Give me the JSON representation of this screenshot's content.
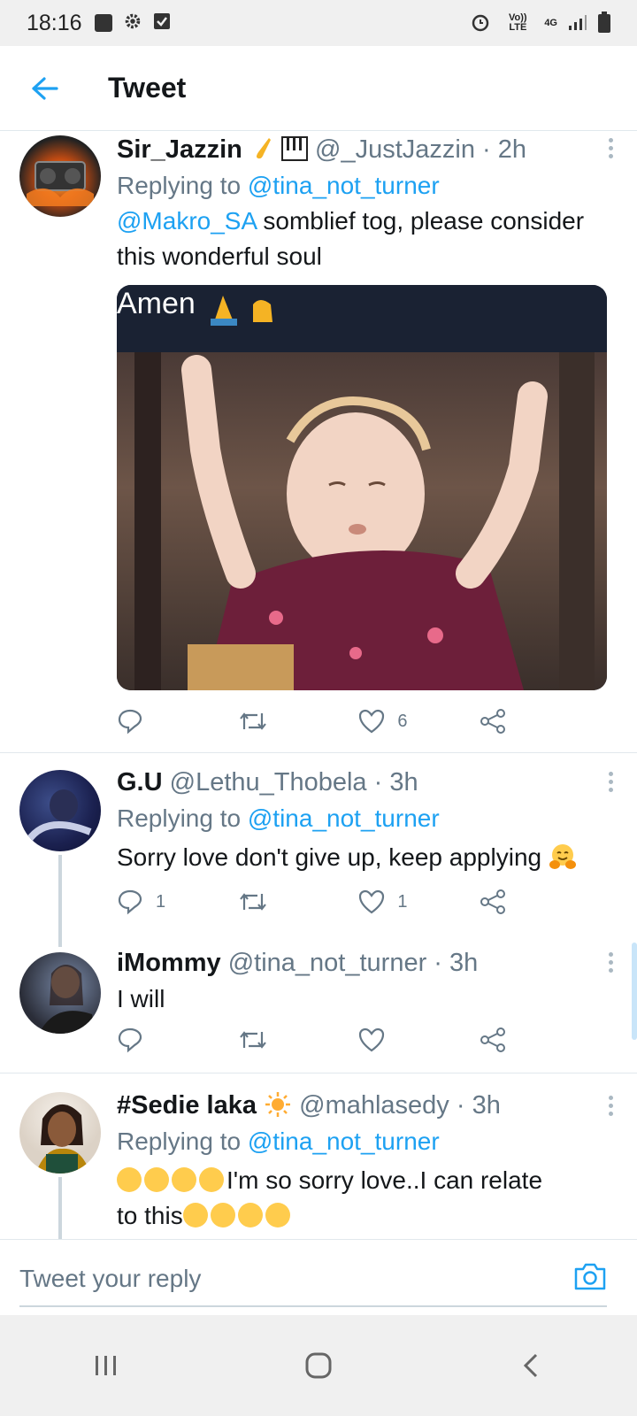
{
  "status_bar": {
    "time": "18:16",
    "net_label": "Vo)) LTE",
    "net_type": "4G"
  },
  "header": {
    "title": "Tweet"
  },
  "tweets": [
    {
      "name": "Sir_Jazzin",
      "handle": "@_JustJazzin",
      "time": "· 2h",
      "replying_prefix": "Replying to",
      "replying_to": "@tina_not_turner",
      "mention": "@Makro_SA",
      "text": " somblief tog, please consider this wonderful soul",
      "media_caption": "Amen",
      "likes": "6"
    },
    {
      "name": "G.U",
      "handle": "@Lethu_Thobela",
      "time": "· 3h",
      "replying_prefix": "Replying to",
      "replying_to": "@tina_not_turner",
      "text": "Sorry love don't give up, keep applying",
      "replies": "1",
      "likes": "1"
    },
    {
      "name": "iMommy",
      "handle": "@tina_not_turner",
      "time": "· 3h",
      "text": "I will"
    },
    {
      "name": "#Sedie laka",
      "handle": "@mahlasedy",
      "time": "· 3h",
      "replying_prefix": "Replying to",
      "replying_to": "@tina_not_turner",
      "text_line1": "I'm so sorry love..I can relate",
      "text_line2": "to this"
    }
  ],
  "reply_bar": {
    "placeholder": "Tweet your reply"
  },
  "colors": {
    "accent": "#1da1f2",
    "muted": "#657786",
    "divider": "#e1e8ed"
  }
}
